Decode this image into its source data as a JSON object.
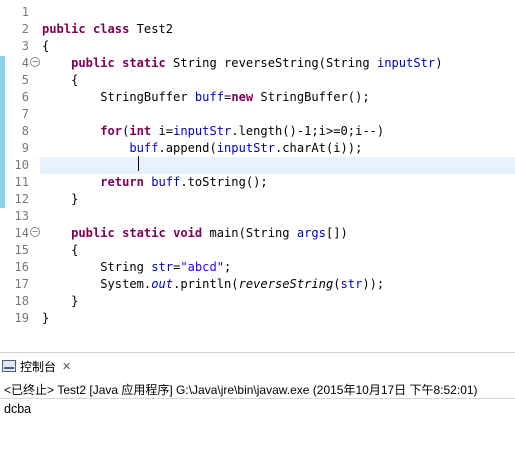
{
  "editor": {
    "line_numbers": [
      "1",
      "2",
      "3",
      "4",
      "5",
      "6",
      "7",
      "8",
      "9",
      "10",
      "11",
      "12",
      "13",
      "14",
      "15",
      "16",
      "17",
      "18",
      "19"
    ],
    "fold_marker": "−",
    "lines": {
      "l2": {
        "kw1": "public",
        "kw2": "class",
        "name": " Test2"
      },
      "l3": {
        "text": "{"
      },
      "l4": {
        "kw1": "public",
        "kw2": "static",
        "t1": " String reverseString(String ",
        "p1": "inputStr",
        "t2": ")"
      },
      "l5": {
        "text": "{"
      },
      "l6": {
        "t1": "StringBuffer ",
        "f1": "buff",
        "t2": "=",
        "kw1": "new",
        "t3": " StringBuffer();"
      },
      "l8": {
        "kw1": "for",
        "t1": "(",
        "kw2": "int",
        "t2": " i=",
        "p1": "inputStr",
        "t3": ".length()-1;i>=0;i--)"
      },
      "l9": {
        "f1": "buff",
        "t1": ".append(",
        "p1": "inputStr",
        "t2": ".charAt(i));"
      },
      "l11": {
        "kw1": "return",
        "t1": " ",
        "f1": "buff",
        "t2": ".toString();"
      },
      "l12": {
        "text": "}"
      },
      "l14": {
        "kw1": "public",
        "kw2": "static",
        "kw3": "void",
        "t1": " main(String ",
        "p1": "args",
        "t2": "[])"
      },
      "l15": {
        "text": "{"
      },
      "l16": {
        "t1": "String ",
        "p1": "str",
        "t2": "=",
        "s1": "\"abcd\"",
        "t3": ";"
      },
      "l17": {
        "t1": "System.",
        "sf1": "out",
        "t2": ".println(",
        "i1": "reverseString",
        "t3": "(",
        "p1": "str",
        "t4": "));"
      },
      "l18": {
        "text": "}"
      },
      "l19": {
        "text": "}"
      }
    }
  },
  "console": {
    "tab_label": "控制台",
    "close_glyph": "✕",
    "status": "<已终止> Test2 [Java 应用程序] G:\\Java\\jre\\bin\\javaw.exe (2015年10月17日 下午8:52:01)",
    "output": "dcba"
  },
  "colors": {
    "keyword": "#7f0055",
    "field": "#0000c0",
    "string": "#2a00ff",
    "line_number": "#787878",
    "current_line": "#e8f2fe",
    "change_bar": "#8ed3e7"
  }
}
